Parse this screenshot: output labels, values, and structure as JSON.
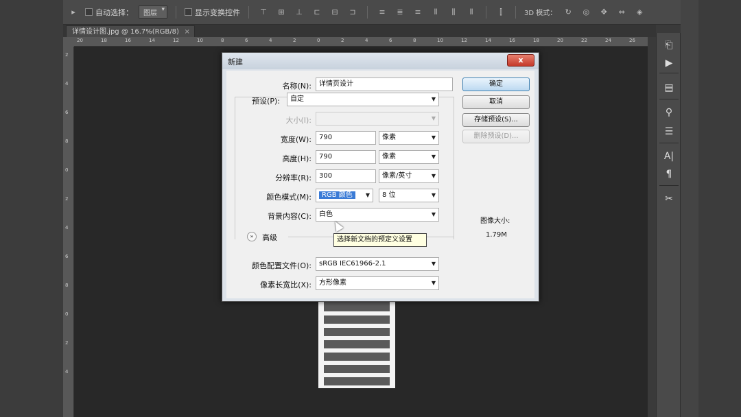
{
  "options_bar": {
    "auto_select_label": "自动选择：",
    "auto_select_value": "图层",
    "show_transform_label": "显示变换控件",
    "mode_3d_label": "3D 模式："
  },
  "doc_tab": {
    "title": "详情设计图.jpg @ 16.7%(RGB/8)",
    "close": "×"
  },
  "ruler_top_ticks": [
    "20",
    "18",
    "16",
    "14",
    "12",
    "10",
    "8",
    "6",
    "4",
    "2",
    "0",
    "2",
    "4",
    "6",
    "8",
    "10",
    "12",
    "14",
    "16",
    "18",
    "20",
    "22",
    "24",
    "26"
  ],
  "ruler_left_ticks": [
    "2",
    "4",
    "6",
    "8",
    "0",
    "2",
    "4",
    "6",
    "8",
    "0",
    "2",
    "4"
  ],
  "dialog": {
    "title": "新建",
    "close": "x",
    "name_label": "名称(N):",
    "name_value": "详情页设计",
    "preset_label": "预设(P):",
    "preset_value": "自定",
    "size_label": "大小(I):",
    "size_value": "",
    "width_label": "宽度(W):",
    "width_value": "790",
    "width_unit": "像素",
    "height_label": "高度(H):",
    "height_value": "790",
    "height_unit": "像素",
    "resolution_label": "分辨率(R):",
    "resolution_value": "300",
    "resolution_unit": "像素/英寸",
    "color_mode_label": "颜色模式(M):",
    "color_mode_value": "RGB 颜色",
    "color_depth_value": "8 位",
    "background_label": "背景内容(C):",
    "background_value": "白色",
    "advanced_toggle": "»",
    "advanced_label": "高级",
    "color_profile_label": "颜色配置文件(O):",
    "color_profile_value": "sRGB IEC61966-2.1",
    "pixel_aspect_label": "像素长宽比(X):",
    "pixel_aspect_value": "方形像素",
    "ok_button": "确定",
    "cancel_button": "取消",
    "save_preset_button": "存储预设(S)...",
    "delete_preset_button": "删除预设(D)...",
    "image_size_label": "图像大小:",
    "image_size_value": "1.79M",
    "tooltip": "选择新文档的预定义设置"
  }
}
